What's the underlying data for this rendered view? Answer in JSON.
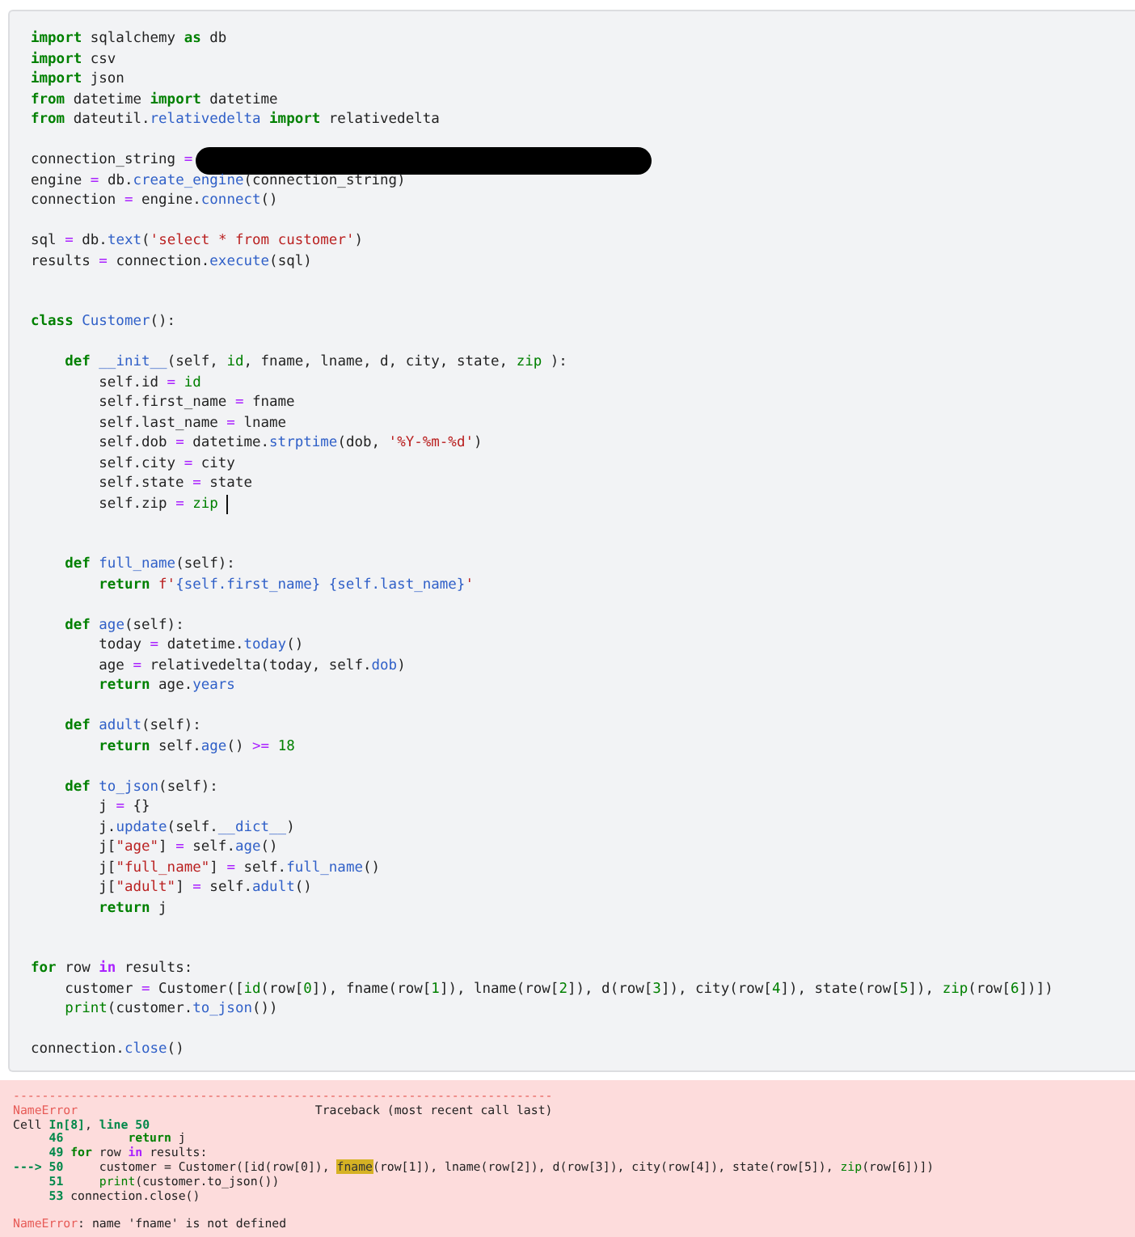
{
  "code_cell": {
    "lines": [
      {
        "kind": "code",
        "segments": [
          {
            "kind": "kw",
            "text": "import"
          },
          {
            "kind": "p",
            "text": " sqlalchemy "
          },
          {
            "kind": "kw",
            "text": "as"
          },
          {
            "kind": "p",
            "text": " db"
          }
        ]
      },
      {
        "kind": "code",
        "segments": [
          {
            "kind": "kw",
            "text": "import"
          },
          {
            "kind": "p",
            "text": " csv"
          }
        ]
      },
      {
        "kind": "code",
        "segments": [
          {
            "kind": "kw",
            "text": "import"
          },
          {
            "kind": "p",
            "text": " json"
          }
        ]
      },
      {
        "kind": "code",
        "segments": [
          {
            "kind": "kw",
            "text": "from"
          },
          {
            "kind": "p",
            "text": " datetime "
          },
          {
            "kind": "kw",
            "text": "import"
          },
          {
            "kind": "p",
            "text": " datetime"
          }
        ]
      },
      {
        "kind": "code",
        "segments": [
          {
            "kind": "kw",
            "text": "from"
          },
          {
            "kind": "p",
            "text": " dateutil."
          },
          {
            "kind": "name",
            "text": "relativedelta "
          },
          {
            "kind": "kw",
            "text": "import"
          },
          {
            "kind": "p",
            "text": " relativedelta"
          }
        ]
      },
      {
        "kind": "blank"
      },
      {
        "kind": "code",
        "segments": [
          {
            "kind": "p",
            "text": "connection_string "
          },
          {
            "kind": "op",
            "text": "="
          },
          {
            "kind": "redacted"
          }
        ]
      },
      {
        "kind": "code",
        "segments": [
          {
            "kind": "p",
            "text": "engine "
          },
          {
            "kind": "op",
            "text": "="
          },
          {
            "kind": "p",
            "text": " db."
          },
          {
            "kind": "name",
            "text": "create_engine"
          },
          {
            "kind": "p",
            "text": "(connection_string)"
          }
        ]
      },
      {
        "kind": "code",
        "segments": [
          {
            "kind": "p",
            "text": "connection "
          },
          {
            "kind": "op",
            "text": "="
          },
          {
            "kind": "p",
            "text": " engine."
          },
          {
            "kind": "name",
            "text": "connect"
          },
          {
            "kind": "p",
            "text": "()"
          }
        ]
      },
      {
        "kind": "blank"
      },
      {
        "kind": "code",
        "segments": [
          {
            "kind": "p",
            "text": "sql "
          },
          {
            "kind": "op",
            "text": "="
          },
          {
            "kind": "p",
            "text": " db."
          },
          {
            "kind": "name",
            "text": "text"
          },
          {
            "kind": "p",
            "text": "("
          },
          {
            "kind": "str",
            "text": "'select * from customer'"
          },
          {
            "kind": "p",
            "text": ")"
          }
        ]
      },
      {
        "kind": "code",
        "segments": [
          {
            "kind": "p",
            "text": "results "
          },
          {
            "kind": "op",
            "text": "="
          },
          {
            "kind": "p",
            "text": " connection."
          },
          {
            "kind": "name",
            "text": "execute"
          },
          {
            "kind": "p",
            "text": "(sql)"
          }
        ]
      },
      {
        "kind": "blank"
      },
      {
        "kind": "blank"
      },
      {
        "kind": "code",
        "segments": [
          {
            "kind": "kw",
            "text": "class "
          },
          {
            "kind": "name",
            "text": "Customer"
          },
          {
            "kind": "p",
            "text": "():"
          }
        ]
      },
      {
        "kind": "blank"
      },
      {
        "kind": "code",
        "segments": [
          {
            "kind": "kw",
            "text": "    def "
          },
          {
            "kind": "name",
            "text": "__init__"
          },
          {
            "kind": "p",
            "text": "(self, "
          },
          {
            "kind": "builtin",
            "text": "id"
          },
          {
            "kind": "p",
            "text": ", fname, lname, d, city, state, "
          },
          {
            "kind": "builtin",
            "text": "zip"
          },
          {
            "kind": "p",
            "text": " ):"
          }
        ]
      },
      {
        "kind": "code",
        "segments": [
          {
            "kind": "p",
            "text": "        self.id "
          },
          {
            "kind": "op",
            "text": "="
          },
          {
            "kind": "builtin",
            "text": " id"
          }
        ]
      },
      {
        "kind": "code",
        "segments": [
          {
            "kind": "p",
            "text": "        self.first_name "
          },
          {
            "kind": "op",
            "text": "="
          },
          {
            "kind": "p",
            "text": " fname"
          }
        ]
      },
      {
        "kind": "code",
        "segments": [
          {
            "kind": "p",
            "text": "        self.last_name "
          },
          {
            "kind": "op",
            "text": "="
          },
          {
            "kind": "p",
            "text": " lname"
          }
        ]
      },
      {
        "kind": "code",
        "segments": [
          {
            "kind": "p",
            "text": "        self.dob "
          },
          {
            "kind": "op",
            "text": "="
          },
          {
            "kind": "p",
            "text": " datetime."
          },
          {
            "kind": "name",
            "text": "strptime"
          },
          {
            "kind": "p",
            "text": "(dob, "
          },
          {
            "kind": "str",
            "text": "'%Y-%m-%d'"
          },
          {
            "kind": "p",
            "text": ")"
          }
        ]
      },
      {
        "kind": "code",
        "segments": [
          {
            "kind": "p",
            "text": "        self.city "
          },
          {
            "kind": "op",
            "text": "="
          },
          {
            "kind": "p",
            "text": " city"
          }
        ]
      },
      {
        "kind": "code",
        "segments": [
          {
            "kind": "p",
            "text": "        self.state "
          },
          {
            "kind": "op",
            "text": "="
          },
          {
            "kind": "p",
            "text": " state"
          }
        ]
      },
      {
        "kind": "code",
        "segments": [
          {
            "kind": "p",
            "text": "        self.zip "
          },
          {
            "kind": "op",
            "text": "="
          },
          {
            "kind": "builtin",
            "text": " zip "
          },
          {
            "kind": "cursor"
          }
        ]
      },
      {
        "kind": "blank"
      },
      {
        "kind": "blank"
      },
      {
        "kind": "code",
        "segments": [
          {
            "kind": "kw",
            "text": "    def "
          },
          {
            "kind": "name",
            "text": "full_name"
          },
          {
            "kind": "p",
            "text": "(self):"
          }
        ]
      },
      {
        "kind": "code",
        "segments": [
          {
            "kind": "kw",
            "text": "        return "
          },
          {
            "kind": "str",
            "text": "f'"
          },
          {
            "kind": "name",
            "text": "{self.first_name} {self.last_name}"
          },
          {
            "kind": "str",
            "text": "'"
          }
        ]
      },
      {
        "kind": "blank"
      },
      {
        "kind": "code",
        "segments": [
          {
            "kind": "kw",
            "text": "    def "
          },
          {
            "kind": "name",
            "text": "age"
          },
          {
            "kind": "p",
            "text": "(self):"
          }
        ]
      },
      {
        "kind": "code",
        "segments": [
          {
            "kind": "p",
            "text": "        today "
          },
          {
            "kind": "op",
            "text": "="
          },
          {
            "kind": "p",
            "text": " datetime."
          },
          {
            "kind": "name",
            "text": "today"
          },
          {
            "kind": "p",
            "text": "()"
          }
        ]
      },
      {
        "kind": "code",
        "segments": [
          {
            "kind": "p",
            "text": "        age "
          },
          {
            "kind": "op",
            "text": "="
          },
          {
            "kind": "p",
            "text": " relativedelta(today, self."
          },
          {
            "kind": "name",
            "text": "dob"
          },
          {
            "kind": "p",
            "text": ")"
          }
        ]
      },
      {
        "kind": "code",
        "segments": [
          {
            "kind": "kw",
            "text": "        return"
          },
          {
            "kind": "p",
            "text": " age."
          },
          {
            "kind": "name",
            "text": "years"
          }
        ]
      },
      {
        "kind": "blank"
      },
      {
        "kind": "code",
        "segments": [
          {
            "kind": "kw",
            "text": "    def "
          },
          {
            "kind": "name",
            "text": "adult"
          },
          {
            "kind": "p",
            "text": "(self):"
          }
        ]
      },
      {
        "kind": "code",
        "segments": [
          {
            "kind": "kw",
            "text": "        return"
          },
          {
            "kind": "p",
            "text": " self."
          },
          {
            "kind": "name",
            "text": "age"
          },
          {
            "kind": "p",
            "text": "() "
          },
          {
            "kind": "op",
            "text": ">="
          },
          {
            "kind": "num",
            "text": " 18"
          }
        ]
      },
      {
        "kind": "blank"
      },
      {
        "kind": "code",
        "segments": [
          {
            "kind": "kw",
            "text": "    def "
          },
          {
            "kind": "name",
            "text": "to_json"
          },
          {
            "kind": "p",
            "text": "(self):"
          }
        ]
      },
      {
        "kind": "code",
        "segments": [
          {
            "kind": "p",
            "text": "        j "
          },
          {
            "kind": "op",
            "text": "="
          },
          {
            "kind": "p",
            "text": " {}"
          }
        ]
      },
      {
        "kind": "code",
        "segments": [
          {
            "kind": "p",
            "text": "        j."
          },
          {
            "kind": "name",
            "text": "update"
          },
          {
            "kind": "p",
            "text": "(self."
          },
          {
            "kind": "name",
            "text": "__dict__"
          },
          {
            "kind": "p",
            "text": ")"
          }
        ]
      },
      {
        "kind": "code",
        "segments": [
          {
            "kind": "p",
            "text": "        j["
          },
          {
            "kind": "str",
            "text": "\"age\""
          },
          {
            "kind": "p",
            "text": "] "
          },
          {
            "kind": "op",
            "text": "="
          },
          {
            "kind": "p",
            "text": " self."
          },
          {
            "kind": "name",
            "text": "age"
          },
          {
            "kind": "p",
            "text": "()"
          }
        ]
      },
      {
        "kind": "code",
        "segments": [
          {
            "kind": "p",
            "text": "        j["
          },
          {
            "kind": "str",
            "text": "\"full_name\""
          },
          {
            "kind": "p",
            "text": "] "
          },
          {
            "kind": "op",
            "text": "="
          },
          {
            "kind": "p",
            "text": " self."
          },
          {
            "kind": "name",
            "text": "full_name"
          },
          {
            "kind": "p",
            "text": "()"
          }
        ]
      },
      {
        "kind": "code",
        "segments": [
          {
            "kind": "p",
            "text": "        j["
          },
          {
            "kind": "str",
            "text": "\"adult\""
          },
          {
            "kind": "p",
            "text": "] "
          },
          {
            "kind": "op",
            "text": "="
          },
          {
            "kind": "p",
            "text": " self."
          },
          {
            "kind": "name",
            "text": "adult"
          },
          {
            "kind": "p",
            "text": "()"
          }
        ]
      },
      {
        "kind": "code",
        "segments": [
          {
            "kind": "kw",
            "text": "        return"
          },
          {
            "kind": "p",
            "text": " j"
          }
        ]
      },
      {
        "kind": "blank"
      },
      {
        "kind": "blank"
      },
      {
        "kind": "code",
        "segments": [
          {
            "kind": "kw",
            "text": "for"
          },
          {
            "kind": "p",
            "text": " row "
          },
          {
            "kind": "kwop",
            "text": "in"
          },
          {
            "kind": "p",
            "text": " results:"
          }
        ]
      },
      {
        "kind": "code",
        "segments": [
          {
            "kind": "p",
            "text": "    customer "
          },
          {
            "kind": "op",
            "text": "="
          },
          {
            "kind": "p",
            "text": " Customer(["
          },
          {
            "kind": "builtin",
            "text": "id"
          },
          {
            "kind": "p",
            "text": "(row["
          },
          {
            "kind": "num",
            "text": "0"
          },
          {
            "kind": "p",
            "text": "]), fname(row["
          },
          {
            "kind": "num",
            "text": "1"
          },
          {
            "kind": "p",
            "text": "]), lname(row["
          },
          {
            "kind": "num",
            "text": "2"
          },
          {
            "kind": "p",
            "text": "]), d(row["
          },
          {
            "kind": "num",
            "text": "3"
          },
          {
            "kind": "p",
            "text": "]), city(row["
          },
          {
            "kind": "num",
            "text": "4"
          },
          {
            "kind": "p",
            "text": "]), state(row["
          },
          {
            "kind": "num",
            "text": "5"
          },
          {
            "kind": "p",
            "text": "]), "
          },
          {
            "kind": "builtin",
            "text": "zip"
          },
          {
            "kind": "p",
            "text": "(row["
          },
          {
            "kind": "num",
            "text": "6"
          },
          {
            "kind": "p",
            "text": "])])"
          }
        ]
      },
      {
        "kind": "code",
        "segments": [
          {
            "kind": "builtin",
            "text": "    print"
          },
          {
            "kind": "p",
            "text": "(customer."
          },
          {
            "kind": "name",
            "text": "to_json"
          },
          {
            "kind": "p",
            "text": "())"
          }
        ]
      },
      {
        "kind": "blank"
      },
      {
        "kind": "code",
        "segments": [
          {
            "kind": "p",
            "text": "connection."
          },
          {
            "kind": "name",
            "text": "close"
          },
          {
            "kind": "p",
            "text": "()"
          }
        ]
      }
    ]
  },
  "error_output": {
    "lines": [
      {
        "kind": "code",
        "segments": [
          {
            "kind": "err",
            "text": "---------------------------------------------------------------------------"
          }
        ]
      },
      {
        "kind": "code",
        "segments": [
          {
            "kind": "err",
            "text": "NameError"
          },
          {
            "kind": "p",
            "text": "                                 Traceback (most recent call last)"
          }
        ]
      },
      {
        "kind": "code",
        "segments": [
          {
            "kind": "p",
            "text": "Cell "
          },
          {
            "kind": "tbnum",
            "text": "In[8]"
          },
          {
            "kind": "p",
            "text": ", "
          },
          {
            "kind": "tbnum",
            "text": "line 50"
          }
        ]
      },
      {
        "kind": "code",
        "segments": [
          {
            "kind": "tbnum",
            "text": "     46"
          },
          {
            "kind": "kw",
            "text": "         return"
          },
          {
            "kind": "p",
            "text": " j"
          }
        ]
      },
      {
        "kind": "code",
        "segments": [
          {
            "kind": "tbnum",
            "text": "     49"
          },
          {
            "kind": "kw",
            "text": " for"
          },
          {
            "kind": "p",
            "text": " row "
          },
          {
            "kind": "kwop",
            "text": "in"
          },
          {
            "kind": "p",
            "text": " results:"
          }
        ]
      },
      {
        "kind": "code",
        "segments": [
          {
            "kind": "tbnum",
            "text": "---> 50"
          },
          {
            "kind": "p",
            "text": "     customer = Customer([id(row[0]), "
          },
          {
            "kind": "hl",
            "text": "fname"
          },
          {
            "kind": "p",
            "text": "(row[1]), lname(row[2]), d(row[3]), city(row[4]), state(row[5]), "
          },
          {
            "kind": "builtin",
            "text": "zip"
          },
          {
            "kind": "p",
            "text": "(row[6])])"
          }
        ]
      },
      {
        "kind": "code",
        "segments": [
          {
            "kind": "tbnum",
            "text": "     51"
          },
          {
            "kind": "builtin",
            "text": "     print"
          },
          {
            "kind": "p",
            "text": "(customer.to_json())"
          }
        ]
      },
      {
        "kind": "code",
        "segments": [
          {
            "kind": "tbnum",
            "text": "     53"
          },
          {
            "kind": "p",
            "text": " connection.close()"
          }
        ]
      },
      {
        "kind": "blank"
      },
      {
        "kind": "code",
        "segments": [
          {
            "kind": "err",
            "text": "NameError"
          },
          {
            "kind": "p",
            "text": ": name 'fname' is not defined"
          }
        ]
      }
    ]
  }
}
